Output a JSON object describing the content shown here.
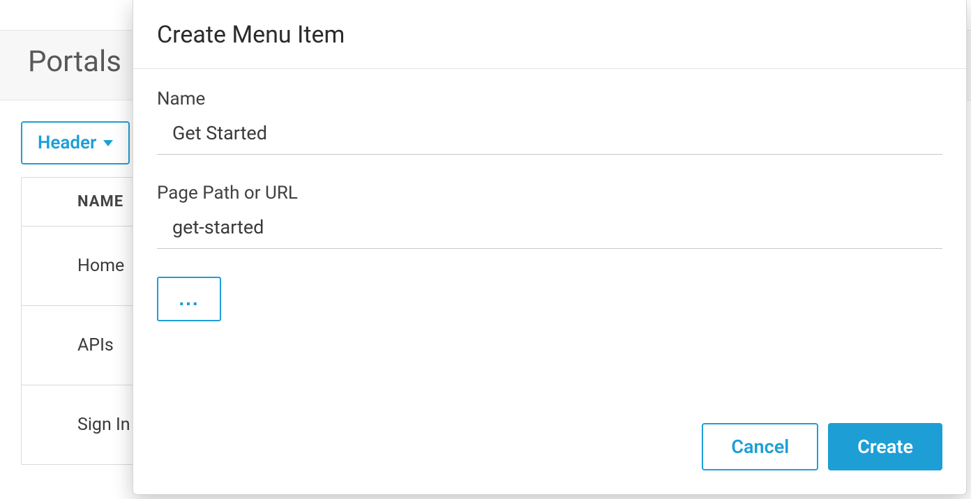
{
  "page": {
    "title": "Portals",
    "dropdown_label": "Header",
    "table": {
      "column_header": "NAME",
      "rows": [
        "Home",
        "APIs",
        "Sign In"
      ]
    }
  },
  "modal": {
    "title": "Create Menu Item",
    "fields": {
      "name": {
        "label": "Name",
        "value": "Get Started"
      },
      "path": {
        "label": "Page Path or URL",
        "value": "get-started"
      }
    },
    "more_label": "...",
    "buttons": {
      "cancel": "Cancel",
      "create": "Create"
    }
  }
}
